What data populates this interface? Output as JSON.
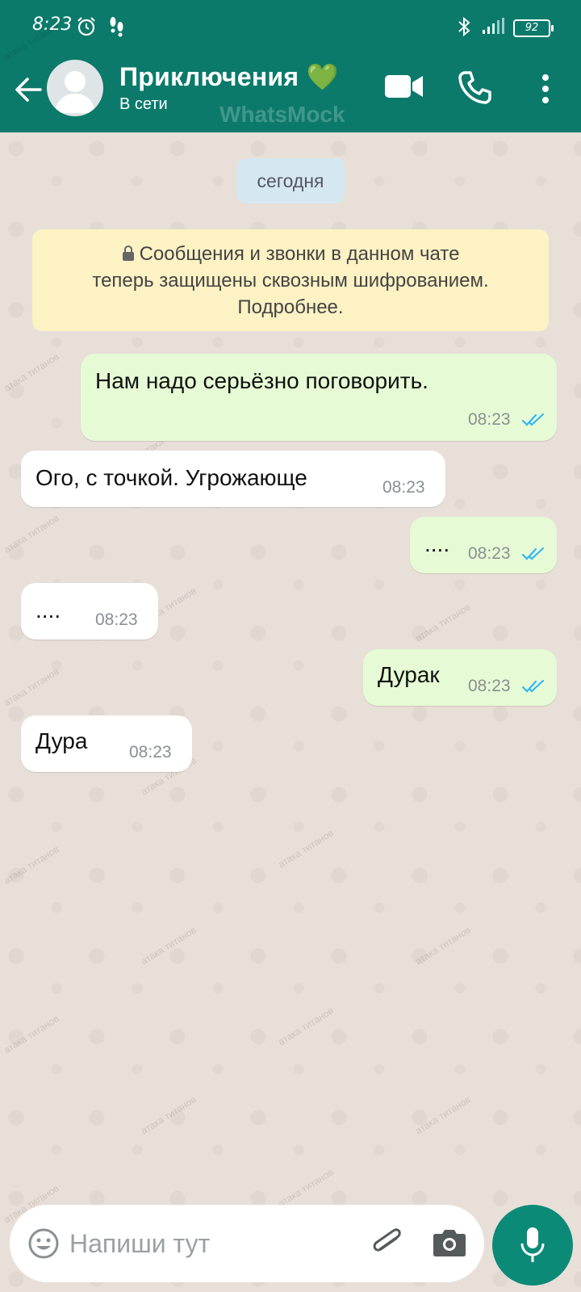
{
  "status_bar": {
    "time": "8:23",
    "battery": "92",
    "icons": [
      "alarm-icon",
      "steps-icon",
      "bluetooth-icon",
      "signal-icon",
      "battery-icon"
    ]
  },
  "header": {
    "title": "Приключения",
    "title_emoji": "💚",
    "status": "В сети",
    "brand_watermark": "WhatsMock",
    "icons": [
      "back-arrow-icon",
      "video-call-icon",
      "voice-call-icon",
      "more-vert-icon"
    ]
  },
  "wallpaper": {
    "watermark_text": "атака титанов"
  },
  "date_chip": "сегодня",
  "encryption_notice": {
    "text": "Сообщения и звонки в данном чате теперь защищены сквозным шифрованием. Подробнее.",
    "line1": "Сообщения и звонки в данном чате",
    "line2": "теперь защищены сквозным шифрованием.",
    "line3": "Подробнее."
  },
  "messages": [
    {
      "direction": "outgoing",
      "text": "Нам надо серьёзно поговорить.",
      "time": "08:23",
      "status": "read"
    },
    {
      "direction": "incoming",
      "text": "Ого, с точкой. Угрожающе",
      "time": "08:23"
    },
    {
      "direction": "outgoing",
      "text": "....",
      "time": "08:23",
      "status": "read"
    },
    {
      "direction": "incoming",
      "text": "....",
      "time": "08:23"
    },
    {
      "direction": "outgoing",
      "text": "Дурак",
      "time": "08:23",
      "status": "read"
    },
    {
      "direction": "incoming",
      "text": "Дура",
      "time": "08:23"
    }
  ],
  "composer": {
    "placeholder": "Напиши тут",
    "value": ""
  },
  "colors": {
    "header": "#0c7a6b",
    "outgoing_bubble": "#e6fbd5",
    "incoming_bubble": "#ffffff",
    "read_ticks": "#34b7f1",
    "mic_button": "#0c8a78",
    "wallpaper": "#e8dfd8"
  }
}
